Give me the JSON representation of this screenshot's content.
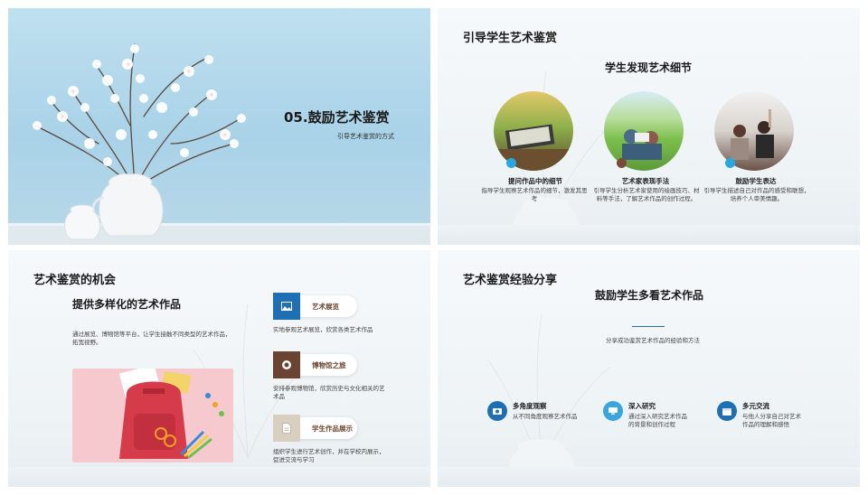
{
  "slide1": {
    "title": "05.鼓励艺术鉴赏",
    "subtitle": "引导艺术鉴赏的方式"
  },
  "slide2": {
    "header": "引导学生艺术鉴赏",
    "subheader": "学生发现艺术细节",
    "items": [
      {
        "title": "提问作品中的细节",
        "desc": "指导学生观察艺术作品的细节，激发其思考",
        "dot_color": "#29a8e0"
      },
      {
        "title": "艺术家表现手法",
        "desc": "引导学生分析艺术家使用的绘画技巧、材料等手法，了解艺术作品的创作过程。",
        "dot_color": "#7a4a3a"
      },
      {
        "title": "鼓励学生表达",
        "desc": "引导学生描述自己对作品的感受和联想，培养个人审美情趣。",
        "dot_color": "#29a8e0"
      }
    ]
  },
  "slide3": {
    "header": "艺术鉴赏的机会",
    "subheader": "提供多样化的艺术作品",
    "body": "通过展览、博物馆等平台，让学生接触不同类型的艺术作品，拓宽视野。",
    "items": [
      {
        "label": "艺术展览",
        "desc": "实地参观艺术展览，欣赏各类艺术作品",
        "color": "#1f6fb5",
        "icon": "image-icon"
      },
      {
        "label": "博物馆之旅",
        "desc": "安排参观博物馆，欣赏历史与文化相关的艺术品",
        "color": "#6b4332",
        "icon": "camera-icon"
      },
      {
        "label": "学生作品展示",
        "desc": "组织学生进行艺术创作，并在学校内展示，促进交流与学习",
        "color": "#d9cfc0",
        "icon": "document-icon"
      }
    ]
  },
  "slide4": {
    "header": "艺术鉴赏经验分享",
    "subheader": "鼓励学生多看艺术作品",
    "caption": "分享成功鉴赏艺术作品的经验和方法",
    "items": [
      {
        "title": "多角度观察",
        "desc": "从不同角度观察艺术作品",
        "color": "#1f6fb5",
        "icon": "eye-icon"
      },
      {
        "title": "深入研究",
        "desc": "通过深入研究艺术作品的背景和创作过程",
        "color": "#3aa6e0",
        "icon": "screen-icon"
      },
      {
        "title": "多元交流",
        "desc": "与他人分享自己对艺术作品的理解和感悟",
        "color": "#1f6fb5",
        "icon": "calendar-icon"
      }
    ]
  }
}
